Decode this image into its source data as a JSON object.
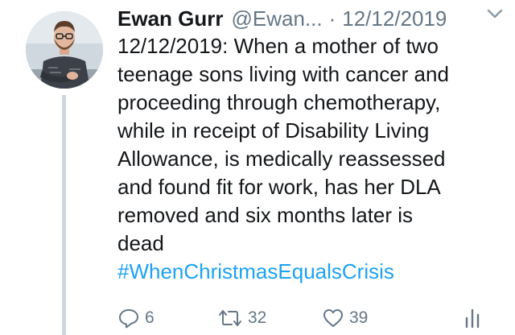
{
  "tweet": {
    "author_name": "Ewan Gurr",
    "handle": "@Ewan...",
    "separator": "·",
    "date": "12/12/2019",
    "text_lines": [
      "12/12/2019: When a mother of two",
      "teenage sons living with cancer and",
      "proceeding through chemotherapy,",
      "while in receipt of Disability Living",
      "Allowance, is medically reassessed",
      "and found fit for work, has her DLA",
      "removed and six months later is",
      "dead"
    ],
    "hashtag": "#WhenChristmasEqualsCrisis"
  },
  "actions": {
    "reply_count": "6",
    "retweet_count": "32",
    "like_count": "39"
  },
  "icons": {
    "caret": "chevron-down-icon",
    "reply": "reply-icon",
    "retweet": "retweet-icon",
    "like": "heart-icon",
    "analytics": "analytics-icon"
  },
  "colors": {
    "text": "#14171a",
    "secondary": "#657786",
    "link": "#1da1f2",
    "thread_line": "#ccd6dd"
  }
}
